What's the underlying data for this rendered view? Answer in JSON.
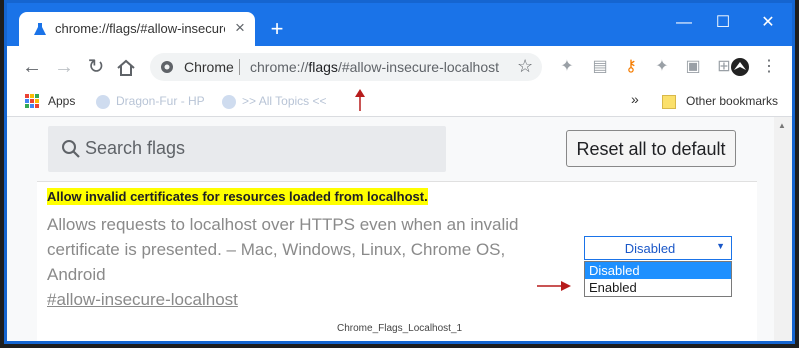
{
  "tab": {
    "title": "chrome://flags/#allow-insecure-l",
    "close": "×",
    "new": "+"
  },
  "window": {
    "minimize": "—",
    "maximize": "☐",
    "close": "✕"
  },
  "omnibox": {
    "site": "Chrome",
    "url_prefix": "chrome://",
    "url_host": "flags",
    "url_suffix": "/#allow-insecure-localhost"
  },
  "bookmarks": {
    "apps": "Apps",
    "item1": "Dragon-Fur - HP",
    "item2": ">> All Topics <<",
    "overflow": "»",
    "other": "Other bookmarks"
  },
  "page": {
    "search_placeholder": "Search flags",
    "reset_label": "Reset all to default",
    "flag": {
      "title": "Allow invalid certificates for resources loaded from localhost.",
      "description": "Allows requests to localhost over HTTPS even when an invalid certificate is presented. – Mac, Windows, Linux, Chrome OS, Android",
      "link": "#allow-insecure-localhost",
      "selected": "Disabled",
      "options": [
        "Disabled",
        "Enabled"
      ]
    },
    "caption": "Chrome_Flags_Localhost_1"
  },
  "colors": {
    "titlebar": "#1a73e8",
    "highlight": "#ffff00",
    "selected_option": "#1e90ff",
    "annotation_arrow": "#b71c1c"
  }
}
